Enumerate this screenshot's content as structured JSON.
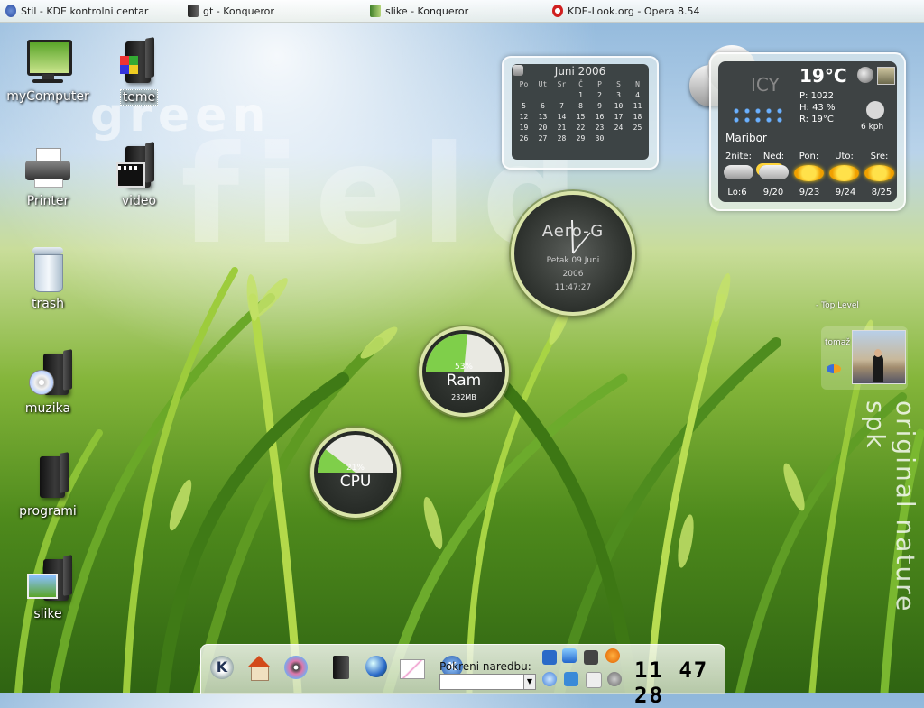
{
  "taskbar": [
    {
      "label": "Stil - KDE kontrolni centar",
      "icon": "kde-control-icon"
    },
    {
      "label": "gt - Konqueror",
      "icon": "konqueror-icon"
    },
    {
      "label": "slike - Konqueror",
      "icon": "konqueror-icon"
    },
    {
      "label": "KDE-Look.org - Opera 8.54",
      "icon": "opera-icon"
    }
  ],
  "desktop_icons": [
    {
      "label": "myComputer",
      "icon": "computer-icon"
    },
    {
      "label": "teme",
      "icon": "themes-folder-icon"
    },
    {
      "label": "Printer",
      "icon": "printer-icon"
    },
    {
      "label": "video",
      "icon": "video-folder-icon"
    },
    {
      "label": "trash",
      "icon": "trash-icon"
    },
    {
      "label": "muzika",
      "icon": "music-folder-icon"
    },
    {
      "label": "programi",
      "icon": "folder-icon"
    },
    {
      "label": "slike",
      "icon": "pictures-folder-icon"
    }
  ],
  "watermark": {
    "green": "green",
    "field": "field",
    "side": "original nature spk"
  },
  "calendar": {
    "title": "Juni 2006",
    "headers": [
      "Po",
      "Ut",
      "Sr",
      "Č",
      "P",
      "S",
      "N"
    ],
    "weeks": [
      [
        "",
        "",
        "",
        "1",
        "2",
        "3",
        "4"
      ],
      [
        "5",
        "6",
        "7",
        "8",
        "9",
        "10",
        "11"
      ],
      [
        "12",
        "13",
        "14",
        "15",
        "16",
        "17",
        "18"
      ],
      [
        "19",
        "20",
        "21",
        "22",
        "23",
        "24",
        "25"
      ],
      [
        "26",
        "27",
        "28",
        "29",
        "30",
        "",
        ""
      ]
    ]
  },
  "weather": {
    "icon_label": "ICY",
    "temperature": "19°C",
    "pressure": "P: 1022",
    "humidity": "H: 43 %",
    "realfeel": "R: 19°C",
    "wind": "6 kph",
    "city": "Maribor",
    "days": [
      "2nite:",
      "Ned:",
      "Pon:",
      "Uto:",
      "Sre:"
    ],
    "lows": [
      "Lo:6",
      "9/20",
      "9/23",
      "9/24",
      "8/25"
    ]
  },
  "clock": {
    "name": "Aero-G",
    "day": "Petak 09 Juni",
    "year": "2006",
    "time": "11:47:27"
  },
  "ram": {
    "percent": "53%",
    "label": "Ram",
    "detail": "232MB",
    "fill": 0.53
  },
  "cpu": {
    "percent": "21%",
    "label": "CPU",
    "fill": 0.21
  },
  "profile": {
    "top_level": "- Top Level",
    "user": "tomaž"
  },
  "panel": {
    "command_label": "Pokreni naredbu:",
    "command_value": "",
    "digital_time": "11 47 28"
  },
  "colors": {
    "gauge_fill": "#7fcf4a",
    "gauge_ring": "#d9e4a8",
    "widget_bg": "#3e4344"
  }
}
